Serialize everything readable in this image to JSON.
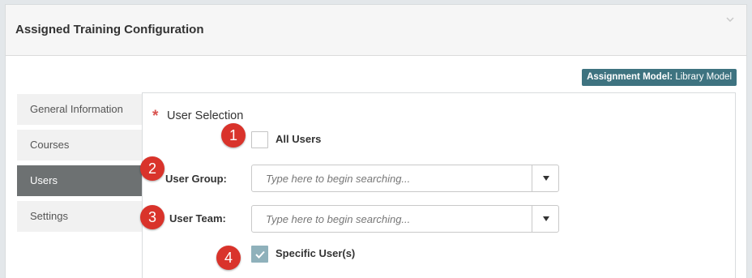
{
  "panel": {
    "title": "Assigned Training Configuration",
    "collapse_icon": "chevron-down-icon"
  },
  "badge": {
    "label": "Assignment Model:",
    "value": "Library Model",
    "color": "#3e7380"
  },
  "tabs": [
    {
      "label": "General Information",
      "active": false
    },
    {
      "label": "Courses",
      "active": false
    },
    {
      "label": "Users",
      "active": true
    },
    {
      "label": "Settings",
      "active": false
    }
  ],
  "user_selection": {
    "required_marker": "*",
    "label": "User Selection",
    "all_users": {
      "label": "All Users",
      "checked": false
    },
    "user_group": {
      "label": "User Group:",
      "placeholder": "Type here to begin searching..."
    },
    "user_team": {
      "label": "User Team:",
      "placeholder": "Type here to begin searching..."
    },
    "specific_users": {
      "label": "Specific User(s)",
      "checked": true
    }
  },
  "markers": [
    "1",
    "2",
    "3",
    "4"
  ],
  "colors": {
    "active_tab": "#6d7172",
    "marker": "#d9332b",
    "required": "#d9534f",
    "checked_box": "#8fb1bb"
  }
}
